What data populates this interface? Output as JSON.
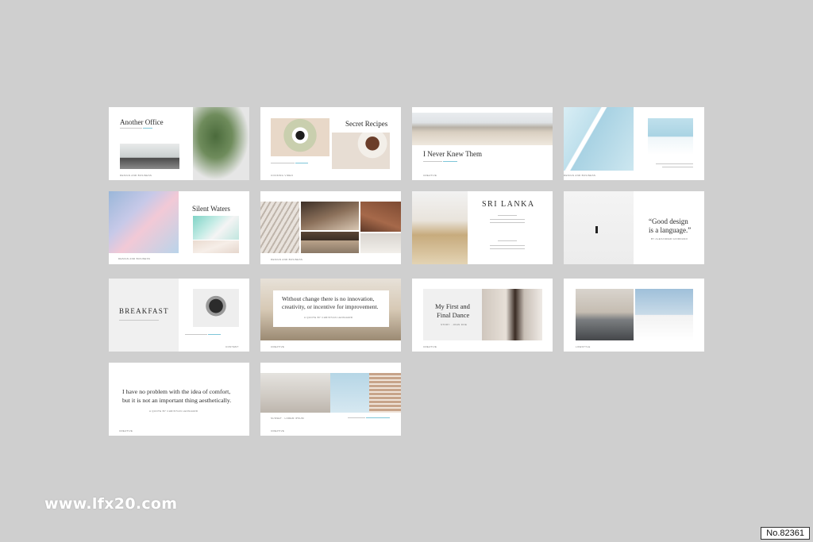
{
  "slides": {
    "s1": {
      "title": "Another Office",
      "footer": "DESIGN AND BUSINESS"
    },
    "s2": {
      "title": "Secret Recipes",
      "footer": "COOKING VIDEO"
    },
    "s3": {
      "title": "I Never Knew Them",
      "footer": "CREATIVE"
    },
    "s4": {
      "footer": "DESIGN AND BUSINESS"
    },
    "s5": {
      "title": "Silent Waters",
      "footer": "DESIGN AND BUSINESS"
    },
    "s6": {
      "footer": "DESIGN AND BUSINESS"
    },
    "s7": {
      "title": "SRI LANKA"
    },
    "s8": {
      "quote_line1": "“Good design",
      "quote_line2": "is a language.”",
      "attribution": "BY ALEXANDER GIORDANO"
    },
    "s9": {
      "title": "BREAKFAST",
      "footer": "CONTENT"
    },
    "s10": {
      "quote_line1": "Without change there is no innovation,",
      "quote_line2": "creativity, or incentive for improvement.",
      "attribution": "A QUOTE BY CHRISTIAN LEONHARD",
      "footer": "CREATIVE"
    },
    "s11": {
      "title_line1": "My First and",
      "title_line2": "Final Dance",
      "subtitle": "STORY · JOHN DOE",
      "footer": "CREATIVE"
    },
    "s12": {
      "footer": "LIFESTYLE"
    },
    "s13": {
      "quote_line1": "I have no problem with the idea of comfort,",
      "quote_line2": "but it is not an important thing aesthetically.",
      "attribution": "A QUOTE BY CHRISTIAN LEONHARD",
      "footer": "CREATIVE"
    },
    "s14": {
      "subtitle": "SUNSET · LOREM IPSUM",
      "footer": "CREATIVE"
    }
  },
  "watermark": "www.lfx20.com",
  "badge": "No.82361"
}
